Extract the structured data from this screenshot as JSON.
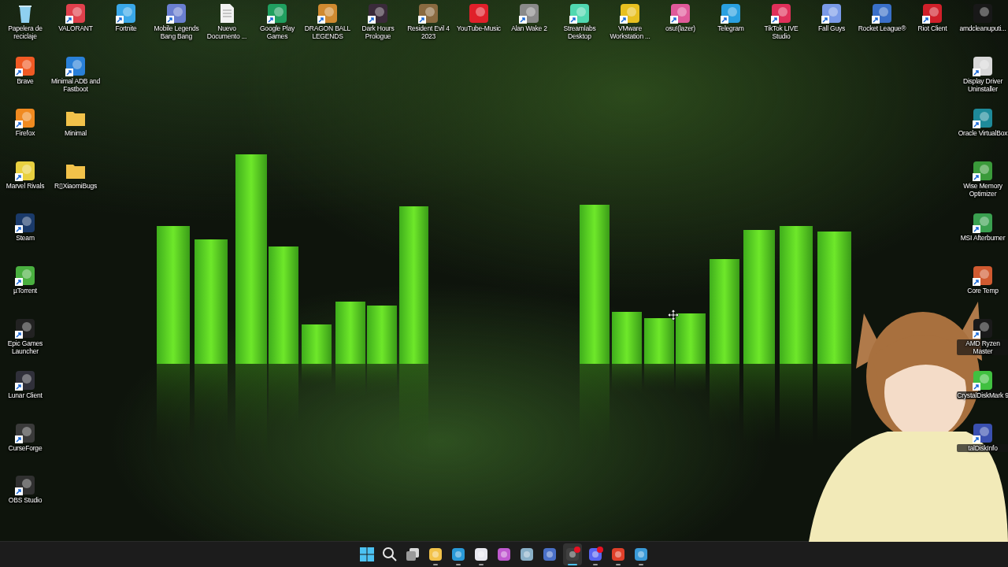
{
  "desktop": {
    "top_row": [
      {
        "label": "Papelera de reciclaje",
        "kind": "recycle-bin",
        "color": "#8fd0f0",
        "shortcut": false
      },
      {
        "label": "VALORANT",
        "kind": "app",
        "color": "#e0404c",
        "shortcut": true
      },
      {
        "label": "Fortnite",
        "kind": "app",
        "color": "#3aa8e8",
        "shortcut": true
      },
      {
        "label": "Mobile Legends Bang Bang",
        "kind": "app",
        "color": "#6a7fd0",
        "shortcut": true
      },
      {
        "label": "Nuevo Documento ...",
        "kind": "document",
        "color": "#f2f2f2",
        "shortcut": false
      },
      {
        "label": "Google Play Games",
        "kind": "app",
        "color": "#20a060",
        "shortcut": true
      },
      {
        "label": "DRAGON BALL LEGENDS",
        "kind": "app",
        "color": "#d08a30",
        "shortcut": true
      },
      {
        "label": "Dark Hours Prologue",
        "kind": "app",
        "color": "#3a2a3a",
        "shortcut": true
      },
      {
        "label": "Resident Evil 4 2023",
        "kind": "app",
        "color": "#8a6a40",
        "shortcut": true
      },
      {
        "label": "YouTube-Music",
        "kind": "app",
        "color": "#e0202a",
        "shortcut": false
      },
      {
        "label": "Alan Wake 2",
        "kind": "app",
        "color": "#8a8a8a",
        "shortcut": true
      },
      {
        "label": "Streamlabs Desktop",
        "kind": "app",
        "color": "#50d8b0",
        "shortcut": true
      },
      {
        "label": "VMware Workstation ...",
        "kind": "app",
        "color": "#e8c020",
        "shortcut": true
      },
      {
        "label": "osu!(lazer)",
        "kind": "app",
        "color": "#e05a9a",
        "shortcut": true
      },
      {
        "label": "Telegram",
        "kind": "app",
        "color": "#2aa0e0",
        "shortcut": true
      },
      {
        "label": "TikTok LIVE Studio",
        "kind": "app",
        "color": "#e0305a",
        "shortcut": true
      },
      {
        "label": "Fall Guys",
        "kind": "app",
        "color": "#7a9ae8",
        "shortcut": true
      },
      {
        "label": "Rocket League®",
        "kind": "app",
        "color": "#3a70c8",
        "shortcut": true
      },
      {
        "label": "Riot Client",
        "kind": "app",
        "color": "#d0202a",
        "shortcut": true
      },
      {
        "label": "amdcleanuputi...",
        "kind": "app",
        "color": "#181818",
        "shortcut": false
      }
    ],
    "left_column": [
      {
        "label": "Brave",
        "kind": "app",
        "color": "#f05a24",
        "shortcut": true
      },
      {
        "label": "Firefox",
        "kind": "app",
        "color": "#f08a20",
        "shortcut": true
      },
      {
        "label": "Marvel Rivals",
        "kind": "app",
        "color": "#e8d040",
        "shortcut": true
      },
      {
        "label": "Steam",
        "kind": "app",
        "color": "#1a3a6a",
        "shortcut": true
      },
      {
        "label": "µTorrent",
        "kind": "app",
        "color": "#4ab040",
        "shortcut": true
      },
      {
        "label": "Epic Games Launcher",
        "kind": "app",
        "color": "#222222",
        "shortcut": true
      },
      {
        "label": "Lunar Client",
        "kind": "app",
        "color": "#30303a",
        "shortcut": true
      },
      {
        "label": "CurseForge",
        "kind": "app",
        "color": "#3a3a3a",
        "shortcut": true
      },
      {
        "label": "OBS Studio",
        "kind": "app",
        "color": "#303030",
        "shortcut": true
      }
    ],
    "second_column": [
      {
        "label": "Minimal ADB and Fastboot",
        "kind": "app",
        "color": "#2a80d8",
        "shortcut": true
      },
      {
        "label": "Minimal",
        "kind": "folder",
        "color": "#f2c24a",
        "shortcut": false
      },
      {
        "label": "R▯XiaomiBugs",
        "kind": "folder",
        "color": "#f2c24a",
        "shortcut": false
      }
    ],
    "right_column": [
      {
        "label": "Display Driver Uninstaller",
        "kind": "app",
        "color": "#d8d8d8",
        "shortcut": true
      },
      {
        "label": "Oracle VirtualBox",
        "kind": "app",
        "color": "#1e8a9a",
        "shortcut": true
      },
      {
        "label": "Wise Memory Optimizer",
        "kind": "app",
        "color": "#3a9a3a",
        "shortcut": true
      },
      {
        "label": "MSI Afterburner",
        "kind": "app",
        "color": "#3aa050",
        "shortcut": true
      },
      {
        "label": "Core Temp",
        "kind": "app",
        "color": "#d05a30",
        "shortcut": true
      },
      {
        "label": "AMD Ryzen Master",
        "kind": "app",
        "color": "#1a1a1a",
        "shortcut": true
      },
      {
        "label": "CrystalDiskMark 9",
        "kind": "app",
        "color": "#40c040",
        "shortcut": true
      },
      {
        "label": "talDiskInfo",
        "kind": "app",
        "color": "#3a50b0",
        "shortcut": true
      }
    ]
  },
  "taskbar": [
    {
      "kind": "start",
      "color": "#4cc2f2",
      "running": false,
      "active": false,
      "badge": false
    },
    {
      "kind": "search",
      "color": "#e8e8e8",
      "running": false,
      "active": false,
      "badge": false
    },
    {
      "kind": "task-view",
      "color": "#9a9a9a",
      "running": false,
      "active": false,
      "badge": false
    },
    {
      "kind": "app",
      "color": "#f2c24a",
      "running": true,
      "active": false,
      "badge": false
    },
    {
      "kind": "app",
      "color": "#2a9ad8",
      "running": true,
      "active": false,
      "badge": false
    },
    {
      "kind": "app",
      "color": "#e8e8f0",
      "running": true,
      "active": false,
      "badge": false
    },
    {
      "kind": "app",
      "color": "#c05ad0",
      "running": false,
      "active": false,
      "badge": false
    },
    {
      "kind": "app",
      "color": "#8ab0c8",
      "running": false,
      "active": false,
      "badge": false
    },
    {
      "kind": "app",
      "color": "#4a70c8",
      "running": false,
      "active": false,
      "badge": false
    },
    {
      "kind": "app",
      "color": "#404040",
      "running": true,
      "active": true,
      "badge": true
    },
    {
      "kind": "app",
      "color": "#5865f2",
      "running": true,
      "active": false,
      "badge": true
    },
    {
      "kind": "app",
      "color": "#e0402a",
      "running": true,
      "active": false,
      "badge": false
    },
    {
      "kind": "app",
      "color": "#3a9ad8",
      "running": true,
      "active": false,
      "badge": false
    }
  ]
}
